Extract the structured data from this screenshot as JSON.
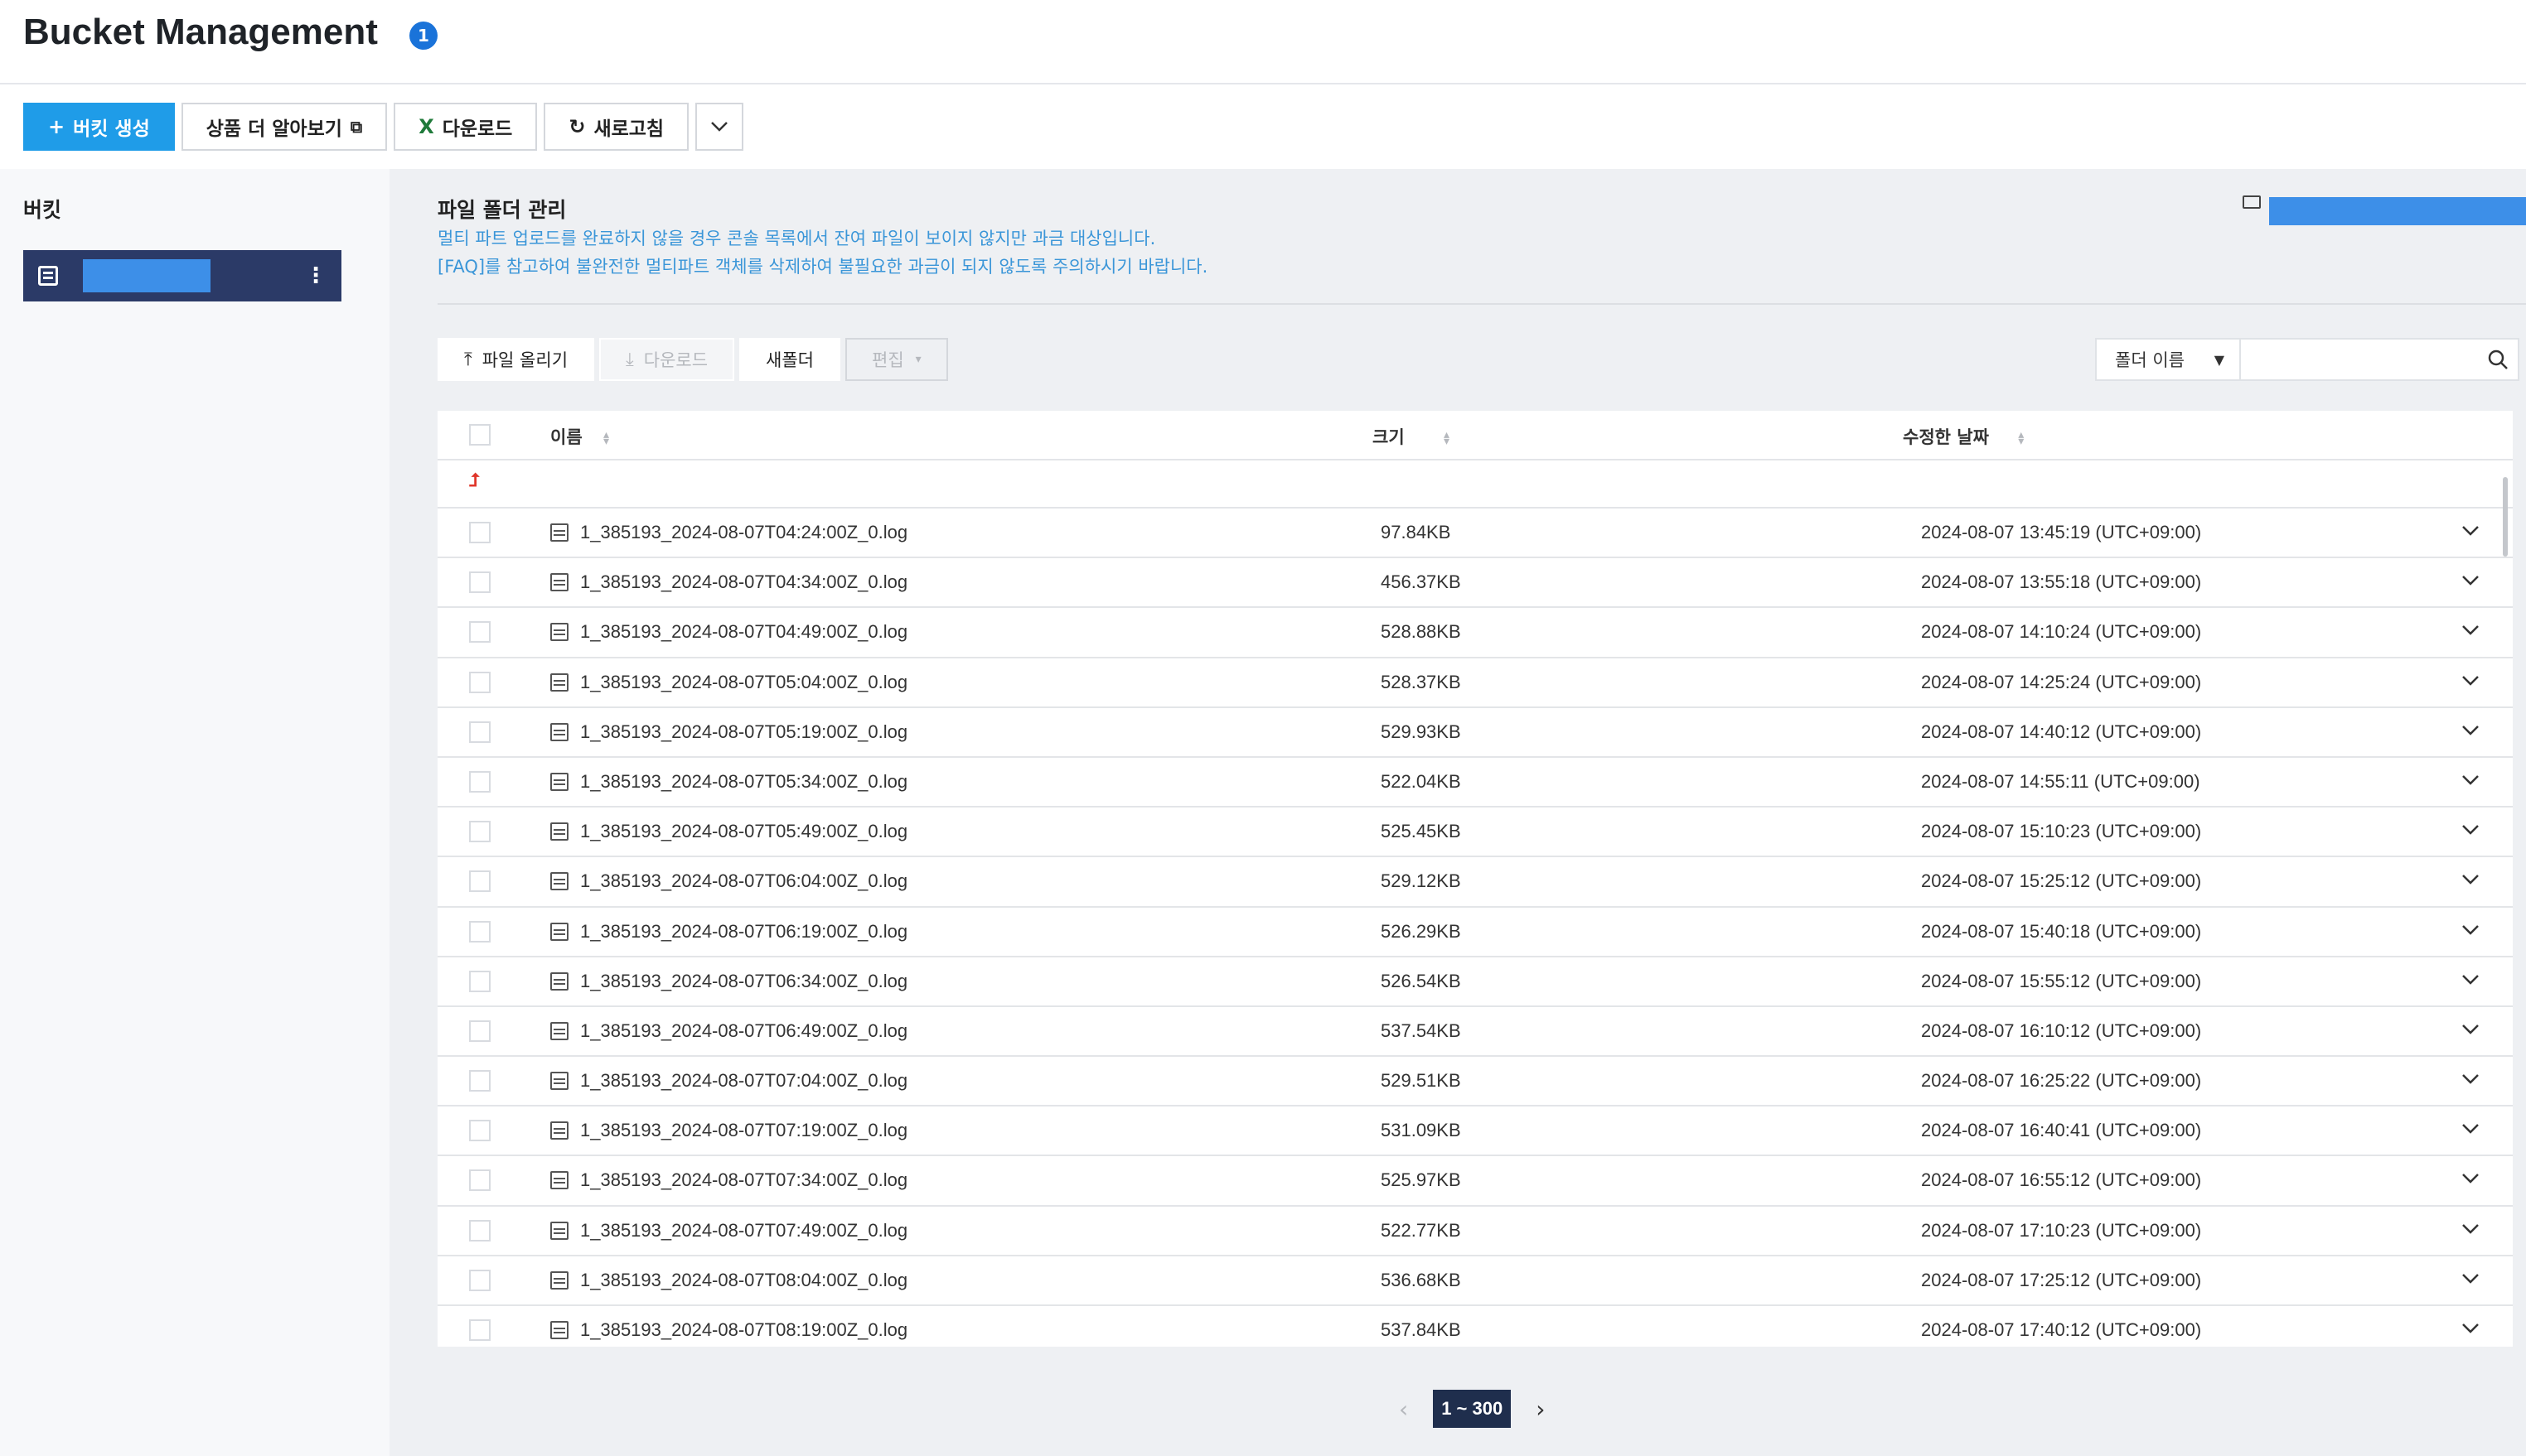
{
  "header": {
    "title": "Bucket Management",
    "badge": "1"
  },
  "toolbar": {
    "create_label": "버킷 생성",
    "learn_more_label": "상품 더 알아보기",
    "download_label": "다운로드",
    "refresh_label": "새로고침"
  },
  "sidebar": {
    "title": "버킷"
  },
  "main": {
    "section_title": "파일 폴더 관리",
    "notice_line1": "멀티 파트 업로드를 완료하지 않을 경우 콘솔 목록에서 잔여 파일이 보이지 않지만 과금 대상입니다.",
    "notice_line2": "[FAQ]를 참고하여 불완전한 멀티파트 객체를 삭제하여 불필요한 과금이 되지 않도록 주의하시기 바랍니다.",
    "actions": {
      "upload_label": "파일 올리기",
      "download_label": "다운로드",
      "new_folder_label": "새폴더",
      "edit_label": "편집"
    },
    "search": {
      "select_label": "폴더 이름",
      "placeholder": ""
    },
    "table": {
      "columns": {
        "name": "이름",
        "size": "크기",
        "date": "수정한 날짜"
      },
      "rows": [
        {
          "name": "1_385193_2024-08-07T04:24:00Z_0.log",
          "size": "97.84KB",
          "date": "2024-08-07 13:45:19 (UTC+09:00)"
        },
        {
          "name": "1_385193_2024-08-07T04:34:00Z_0.log",
          "size": "456.37KB",
          "date": "2024-08-07 13:55:18 (UTC+09:00)"
        },
        {
          "name": "1_385193_2024-08-07T04:49:00Z_0.log",
          "size": "528.88KB",
          "date": "2024-08-07 14:10:24 (UTC+09:00)"
        },
        {
          "name": "1_385193_2024-08-07T05:04:00Z_0.log",
          "size": "528.37KB",
          "date": "2024-08-07 14:25:24 (UTC+09:00)"
        },
        {
          "name": "1_385193_2024-08-07T05:19:00Z_0.log",
          "size": "529.93KB",
          "date": "2024-08-07 14:40:12 (UTC+09:00)"
        },
        {
          "name": "1_385193_2024-08-07T05:34:00Z_0.log",
          "size": "522.04KB",
          "date": "2024-08-07 14:55:11 (UTC+09:00)"
        },
        {
          "name": "1_385193_2024-08-07T05:49:00Z_0.log",
          "size": "525.45KB",
          "date": "2024-08-07 15:10:23 (UTC+09:00)"
        },
        {
          "name": "1_385193_2024-08-07T06:04:00Z_0.log",
          "size": "529.12KB",
          "date": "2024-08-07 15:25:12 (UTC+09:00)"
        },
        {
          "name": "1_385193_2024-08-07T06:19:00Z_0.log",
          "size": "526.29KB",
          "date": "2024-08-07 15:40:18 (UTC+09:00)"
        },
        {
          "name": "1_385193_2024-08-07T06:34:00Z_0.log",
          "size": "526.54KB",
          "date": "2024-08-07 15:55:12 (UTC+09:00)"
        },
        {
          "name": "1_385193_2024-08-07T06:49:00Z_0.log",
          "size": "537.54KB",
          "date": "2024-08-07 16:10:12 (UTC+09:00)"
        },
        {
          "name": "1_385193_2024-08-07T07:04:00Z_0.log",
          "size": "529.51KB",
          "date": "2024-08-07 16:25:22 (UTC+09:00)"
        },
        {
          "name": "1_385193_2024-08-07T07:19:00Z_0.log",
          "size": "531.09KB",
          "date": "2024-08-07 16:40:41 (UTC+09:00)"
        },
        {
          "name": "1_385193_2024-08-07T07:34:00Z_0.log",
          "size": "525.97KB",
          "date": "2024-08-07 16:55:12 (UTC+09:00)"
        },
        {
          "name": "1_385193_2024-08-07T07:49:00Z_0.log",
          "size": "522.77KB",
          "date": "2024-08-07 17:10:23 (UTC+09:00)"
        },
        {
          "name": "1_385193_2024-08-07T08:04:00Z_0.log",
          "size": "536.68KB",
          "date": "2024-08-07 17:25:12 (UTC+09:00)"
        },
        {
          "name": "1_385193_2024-08-07T08:19:00Z_0.log",
          "size": "537.84KB",
          "date": "2024-08-07 17:40:12 (UTC+09:00)"
        }
      ]
    },
    "pagination": {
      "current": "1 ~ 300"
    }
  },
  "colors": {
    "primary": "#1f9ce8",
    "sidebar_selected": "#2b3a67",
    "notice": "#3b96d8",
    "badge": "#1a73d9"
  }
}
